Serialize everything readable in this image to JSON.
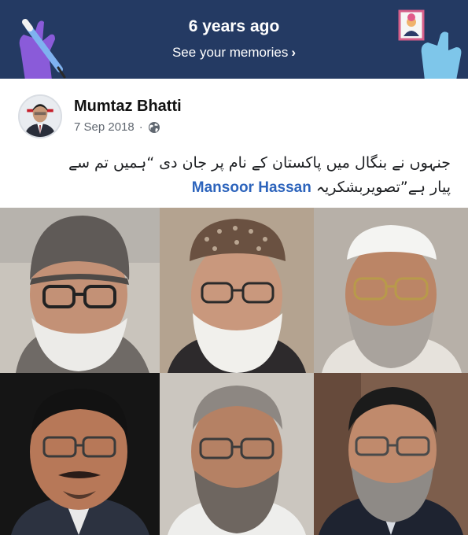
{
  "memories": {
    "title": "6 years ago",
    "link_label": "See your memories",
    "chevron": "›",
    "background": "#243a63"
  },
  "post": {
    "author": "Mumtaz Bhatti",
    "date": "7 Sep 2018",
    "separator": "·",
    "privacy_icon": "globe-icon",
    "text_line_1": "جنہوں نے بنگال میں پاکستان کے نام پر جان دی “ہمیں تم سے",
    "text_line_2": "پیار ہے”تصویربشکریہ ",
    "mention": "Mansoor Hassan",
    "mention_color": "#2d64bc"
  },
  "photos": {
    "count": 6,
    "subjects": [
      "portrait-1",
      "portrait-2",
      "portrait-3",
      "portrait-4",
      "portrait-5",
      "portrait-6"
    ]
  }
}
